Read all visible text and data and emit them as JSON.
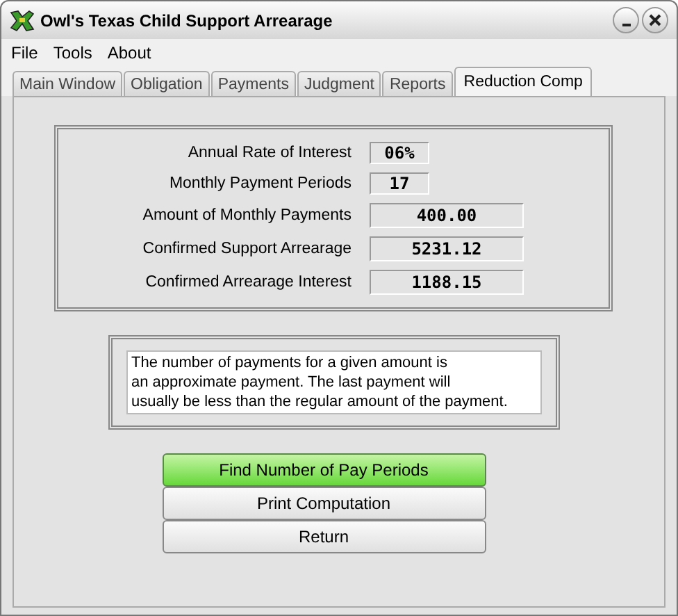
{
  "window": {
    "title": "Owl's Texas Child Support Arrearage"
  },
  "menu": [
    "File",
    "Tools",
    "About"
  ],
  "tabs": [
    {
      "label": "Main Window",
      "selected": false
    },
    {
      "label": "Obligation",
      "selected": false
    },
    {
      "label": "Payments",
      "selected": false
    },
    {
      "label": "Judgment",
      "selected": false
    },
    {
      "label": "Reports",
      "selected": false
    },
    {
      "label": "Reduction Comp",
      "selected": true
    }
  ],
  "fields": [
    {
      "label": "Annual Rate of Interest",
      "value": "06%",
      "kind": "short"
    },
    {
      "label": "Monthly Payment Periods",
      "value": "17",
      "kind": "short"
    },
    {
      "label": "Amount of Monthly Payments",
      "value": "400.00",
      "kind": "long"
    },
    {
      "label": "Confirmed Support Arrearage",
      "value": "5231.12",
      "kind": "long"
    },
    {
      "label": "Confirmed Arrearage Interest",
      "value": "1188.15",
      "kind": "long"
    }
  ],
  "note": [
    "The number of payments for a given amount is",
    "an approximate payment.  The last payment will",
    "usually be less than the regular amount of the payment."
  ],
  "buttons": [
    {
      "label": "Find Number of Pay Periods",
      "highlighted": true
    },
    {
      "label": "Print Computation",
      "highlighted": false
    },
    {
      "label": "Return",
      "highlighted": false
    }
  ]
}
